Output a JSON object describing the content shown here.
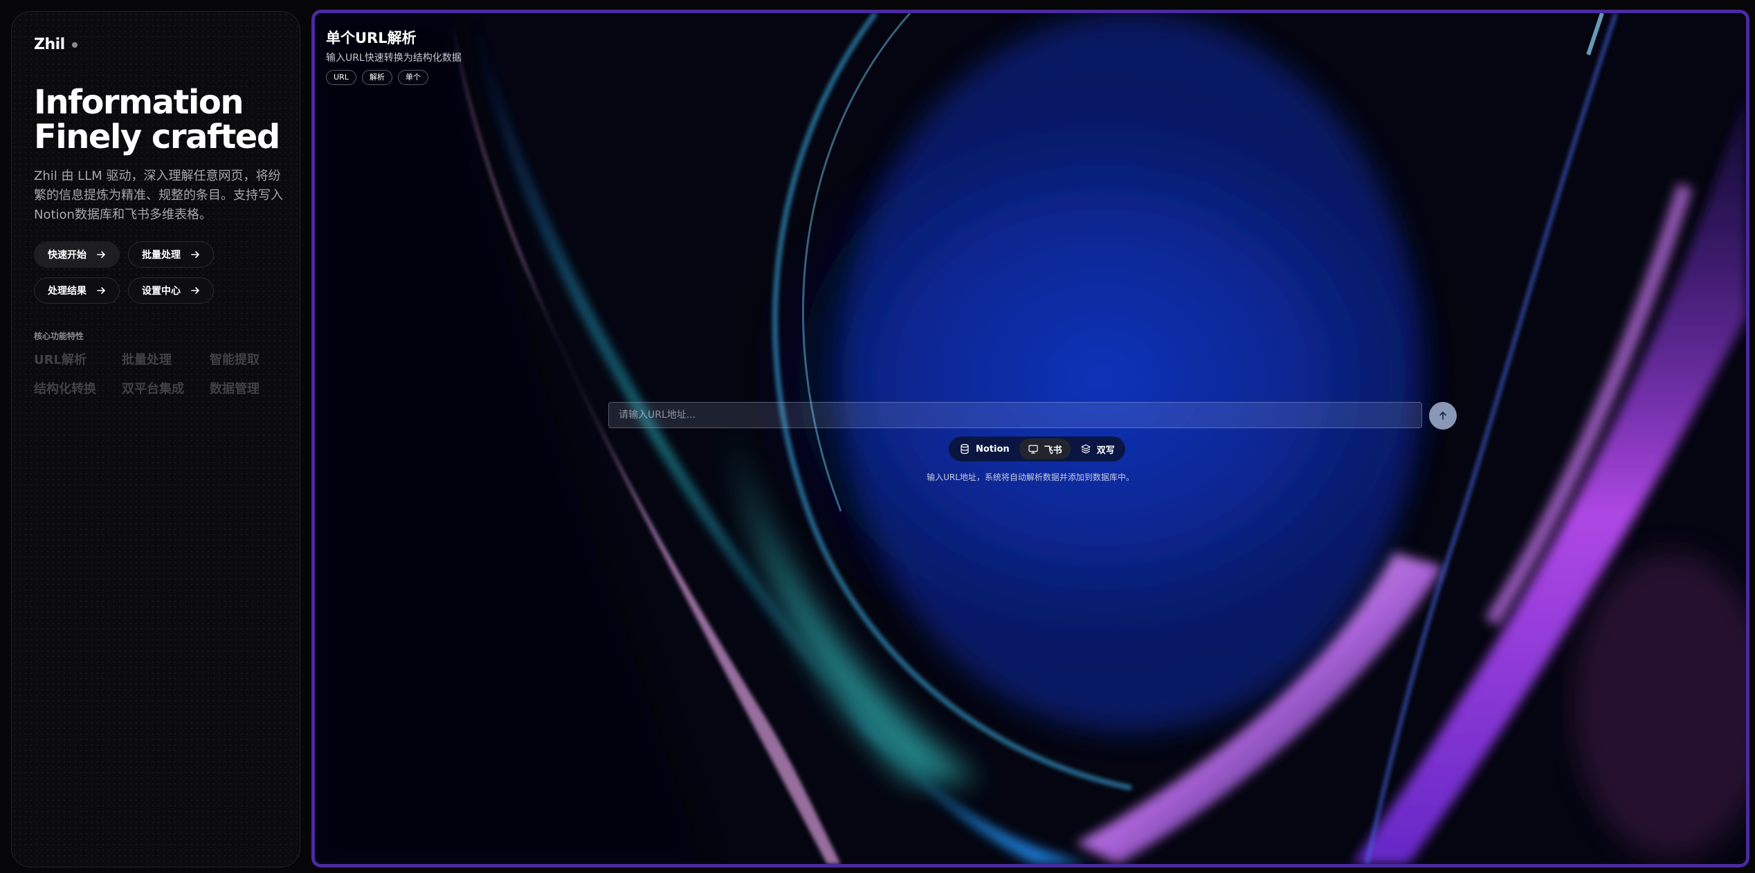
{
  "sidebar": {
    "logo": "Zhil",
    "hero": {
      "line1": "Information",
      "line2": "Finely crafted"
    },
    "description": "Zhil 由 LLM 驱动，深入理解任意网页，将纷繁的信息提炼为精准、规整的条目。支持写入Notion数据库和飞书多维表格。",
    "nav_buttons": [
      {
        "label": "快速开始",
        "icon": "arrow-right-icon",
        "active": true
      },
      {
        "label": "批量处理",
        "icon": "arrow-right-icon",
        "active": false
      },
      {
        "label": "处理结果",
        "icon": "arrow-right-icon",
        "active": false
      },
      {
        "label": "设置中心",
        "icon": "arrow-right-icon",
        "active": false
      }
    ],
    "features": {
      "title": "核心功能特性",
      "items": [
        "URL解析",
        "批量处理",
        "智能提取",
        "结构化转换",
        "双平台集成",
        "数据管理"
      ]
    }
  },
  "main": {
    "title": "单个URL解析",
    "subtitle": "输入URL快速转换为结构化数据",
    "tags": [
      "URL",
      "解析",
      "单个"
    ],
    "url_input": {
      "placeholder": "请输入URL地址...",
      "value": ""
    },
    "submit_icon": "arrow-up-icon",
    "modes": [
      {
        "label": "Notion",
        "icon": "database-icon",
        "active": false
      },
      {
        "label": "飞书",
        "icon": "monitor-icon",
        "active": true
      },
      {
        "label": "双写",
        "icon": "layers-icon",
        "active": false
      }
    ],
    "hint": "输入URL地址，系统将自动解析数据并添加到数据库中。"
  },
  "colors": {
    "panel_border": "#4b2aa0",
    "background": "#060608",
    "send_button": "#8a98b8"
  }
}
